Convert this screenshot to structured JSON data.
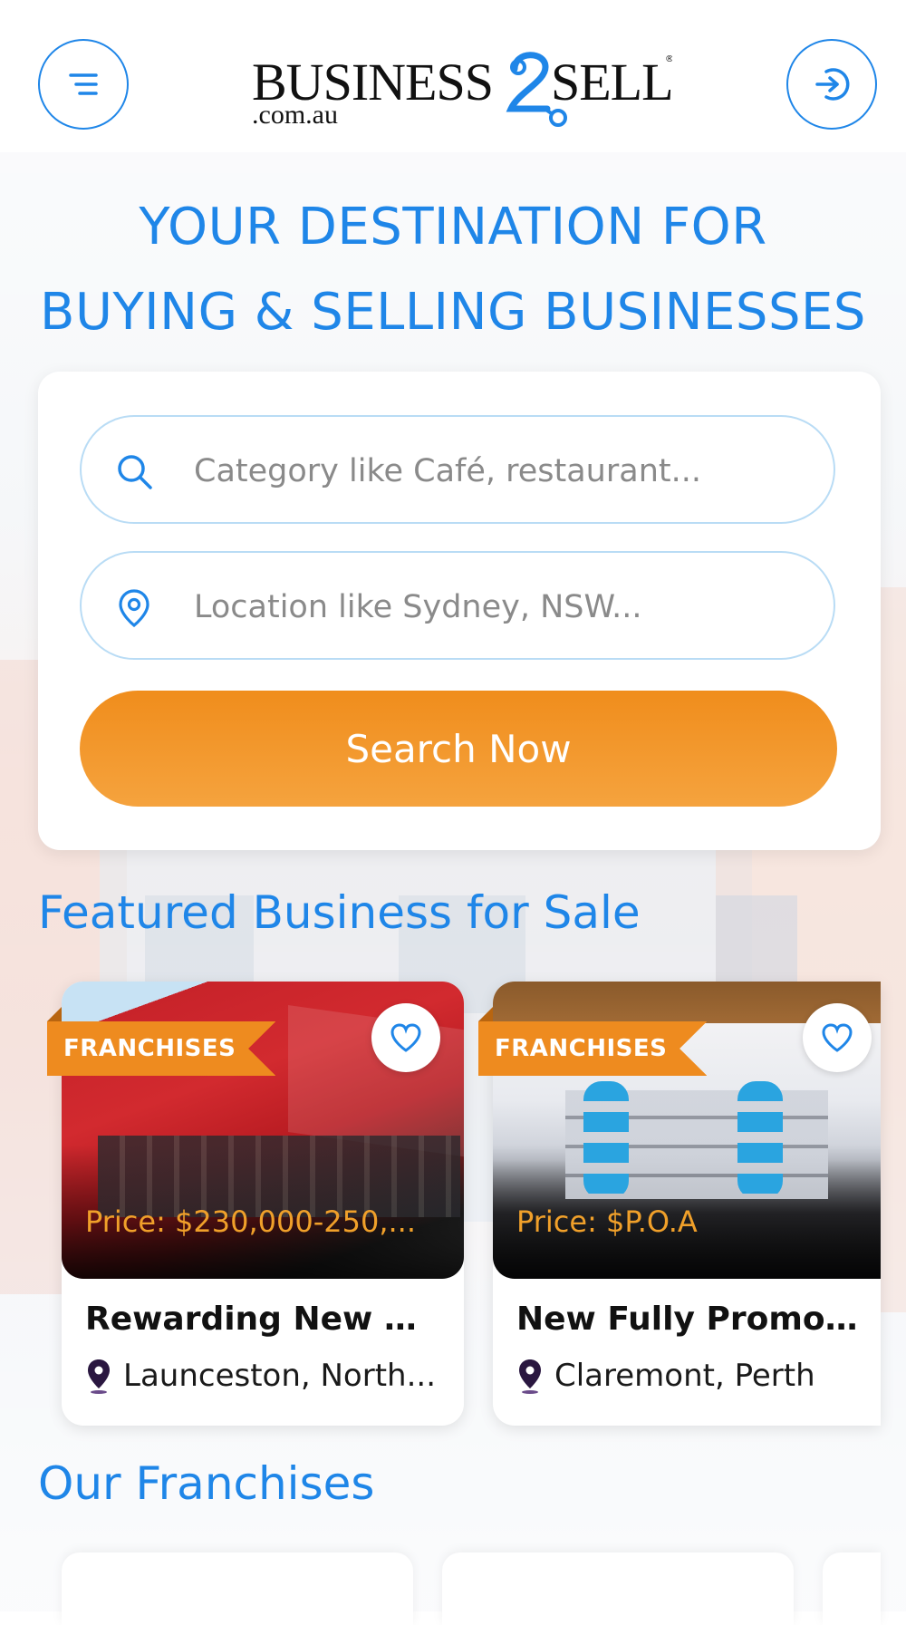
{
  "header": {
    "logo_text": "BUSINESS2SELL",
    "logo_domain": ".com.au",
    "logo_reg": "®",
    "menu_icon": "menu-lines-icon",
    "login_icon": "sign-in-icon"
  },
  "hero": {
    "line1": "YOUR DESTINATION FOR",
    "line2": "BUYING & SELLING BUSINESSES"
  },
  "search": {
    "category_placeholder": "Category like Café, restaurant...",
    "category_value": "",
    "location_placeholder": "Location like Sydney, NSW...",
    "location_value": "",
    "button_label": "Search Now"
  },
  "featured": {
    "title": "Featured Business for Sale",
    "listings": [
      {
        "badge": "FRANCHISES",
        "price": "Price: $230,000-250,...",
        "title": "Rewarding New Sig...",
        "location": "Launceston, North..."
      },
      {
        "badge": "FRANCHISES",
        "price": "Price: $P.O.A",
        "title": "New Fully Promote...",
        "location": "Claremont, Perth"
      }
    ]
  },
  "franchises": {
    "title": "Our Franchises"
  },
  "colors": {
    "primary_blue": "#1f86e8",
    "accent_orange": "#ee8b1f",
    "price_orange": "#f0a02a",
    "pin_purple": "#2a1740"
  }
}
